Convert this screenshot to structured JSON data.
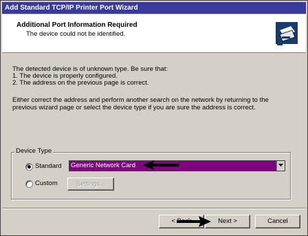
{
  "window": {
    "title": "Add Standard TCP/IP Printer Port Wizard"
  },
  "header": {
    "title": "Additional Port Information Required",
    "subtitle": "The device could not be identified."
  },
  "body": {
    "line1": "The detected device is of unknown type.  Be sure that:",
    "line2": "1. The device is properly configured.",
    "line3": "2.  The address on the previous page is correct.",
    "line4": "Either correct the address and perform another search on the network by returning to the",
    "line5": "previous wizard page or select the device type if you are sure the address is correct."
  },
  "device_type": {
    "group_label": "Device Type",
    "standard_label": "Standard",
    "custom_label": "Custom",
    "selected_option": "Generic Network Card",
    "settings_label": "Settings...",
    "selected_radio": "Standard"
  },
  "footer": {
    "back_label": "< Back",
    "next_label": "Next >",
    "cancel_label": "Cancel"
  },
  "colors": {
    "titlebar": "#3a3a9a",
    "select_highlight": "#800080",
    "face": "#d4d0c8"
  }
}
